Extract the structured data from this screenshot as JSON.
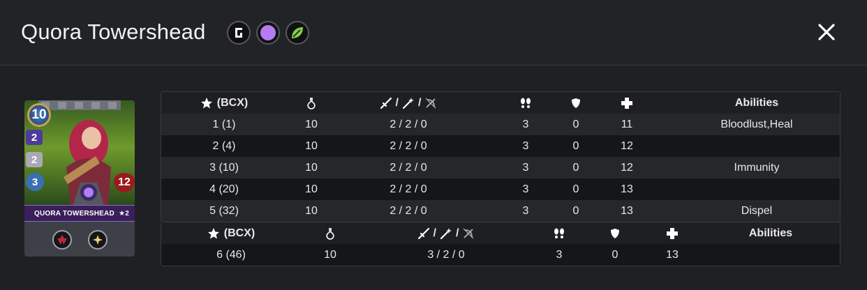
{
  "modal": {
    "title": "Quora Towershead",
    "badges": [
      "rarity-g-icon",
      "purple-orb-icon",
      "leaf-icon"
    ],
    "close_icon": "close-icon"
  },
  "card": {
    "name": "QUORA TOWERSHEAD",
    "level": "★2",
    "mana": "10",
    "attack": "2",
    "magic": "2",
    "speed": "3",
    "health": "12",
    "abilities_icons": [
      "bloodlust-icon",
      "heal-icon"
    ]
  },
  "table1": {
    "headers": {
      "bcx": "(BCX)",
      "abilities": "Abilities",
      "attack_sep": "/"
    },
    "rows": [
      {
        "level": "1 (1)",
        "mana": "10",
        "attack": "2 / 2 / 0",
        "speed": "3",
        "armor": "0",
        "health": "11",
        "abilities": "Bloodlust,Heal"
      },
      {
        "level": "2 (4)",
        "mana": "10",
        "attack": "2 / 2 / 0",
        "speed": "3",
        "armor": "0",
        "health": "12",
        "abilities": ""
      },
      {
        "level": "3 (10)",
        "mana": "10",
        "attack": "2 / 2 / 0",
        "speed": "3",
        "armor": "0",
        "health": "12",
        "abilities": "Immunity"
      },
      {
        "level": "4 (20)",
        "mana": "10",
        "attack": "2 / 2 / 0",
        "speed": "3",
        "armor": "0",
        "health": "13",
        "abilities": ""
      },
      {
        "level": "5 (32)",
        "mana": "10",
        "attack": "2 / 2 / 0",
        "speed": "3",
        "armor": "0",
        "health": "13",
        "abilities": "Dispel"
      }
    ]
  },
  "table2": {
    "headers": {
      "bcx": "(BCX)",
      "abilities": "Abilities",
      "attack_sep": "/"
    },
    "rows": [
      {
        "level": "6 (46)",
        "mana": "10",
        "attack": "3 / 2 / 0",
        "speed": "3",
        "armor": "0",
        "health": "13",
        "abilities": ""
      }
    ]
  }
}
